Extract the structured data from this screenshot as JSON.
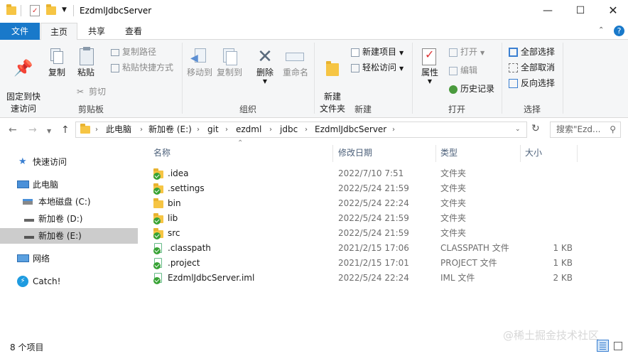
{
  "window": {
    "title": "EzdmlJdbcServer"
  },
  "tabs": {
    "file": "文件",
    "home": "主页",
    "share": "共享",
    "view": "查看"
  },
  "ribbon": {
    "clipboard": {
      "label": "剪贴板",
      "pin": "固定到快\n速访问",
      "copy": "复制",
      "paste": "粘贴",
      "copy_path": "复制路径",
      "paste_shortcut": "粘贴快捷方式",
      "cut": "剪切"
    },
    "organize": {
      "label": "组织",
      "move_to": "移动到",
      "copy_to": "复制到",
      "delete": "删除",
      "rename": "重命名"
    },
    "new": {
      "label": "新建",
      "new_folder": "新建\n文件夹",
      "new_item": "新建项目",
      "easy_access": "轻松访问"
    },
    "open": {
      "label": "打开",
      "properties": "属性",
      "open": "打开",
      "edit": "编辑",
      "history": "历史记录"
    },
    "select": {
      "label": "选择",
      "select_all": "全部选择",
      "select_none": "全部取消",
      "invert": "反向选择"
    }
  },
  "breadcrumb": [
    "此电脑",
    "新加卷 (E:)",
    "git",
    "ezdml",
    "jdbc",
    "EzdmlJdbcServer"
  ],
  "search": {
    "placeholder": "搜索\"Ezd..."
  },
  "sidebar": {
    "quick_access": "快速访问",
    "this_pc": "此电脑",
    "drive_c": "本地磁盘 (C:)",
    "drive_d": "新加卷 (D:)",
    "drive_e": "新加卷 (E:)",
    "network": "网络",
    "catch": "Catch!"
  },
  "columns": {
    "name": "名称",
    "date": "修改日期",
    "type": "类型",
    "size": "大小"
  },
  "files": [
    {
      "name": ".idea",
      "date": "2022/7/10 7:51",
      "type": "文件夹",
      "size": "",
      "kind": "folder"
    },
    {
      "name": ".settings",
      "date": "2022/5/24 21:59",
      "type": "文件夹",
      "size": "",
      "kind": "folder"
    },
    {
      "name": "bin",
      "date": "2022/5/24 22:24",
      "type": "文件夹",
      "size": "",
      "kind": "folder-plain"
    },
    {
      "name": "lib",
      "date": "2022/5/24 21:59",
      "type": "文件夹",
      "size": "",
      "kind": "folder"
    },
    {
      "name": "src",
      "date": "2022/5/24 21:59",
      "type": "文件夹",
      "size": "",
      "kind": "folder"
    },
    {
      "name": ".classpath",
      "date": "2021/2/15 17:06",
      "type": "CLASSPATH 文件",
      "size": "1 KB",
      "kind": "file"
    },
    {
      "name": ".project",
      "date": "2021/2/15 17:01",
      "type": "PROJECT 文件",
      "size": "1 KB",
      "kind": "file"
    },
    {
      "name": "EzdmlJdbcServer.iml",
      "date": "2022/5/24 22:24",
      "type": "IML 文件",
      "size": "2 KB",
      "kind": "file"
    }
  ],
  "status": {
    "count": "8 个项目"
  },
  "watermark": "@稀土掘金技术社区",
  "colors": {
    "accent": "#1979ca",
    "folder": "#f6c544",
    "check": "#38a335"
  }
}
